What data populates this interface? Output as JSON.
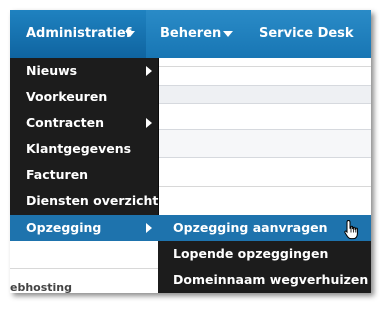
{
  "navbar": {
    "items": [
      {
        "label": "Administratief",
        "has_caret": true,
        "active": true
      },
      {
        "label": "Beheren",
        "has_caret": true,
        "active": false
      },
      {
        "label": "Service Desk",
        "has_caret": false,
        "active": false
      }
    ]
  },
  "dropdown": {
    "items": [
      {
        "label": "Nieuws",
        "has_submenu": true
      },
      {
        "label": "Voorkeuren",
        "has_submenu": false
      },
      {
        "label": "Contracten",
        "has_submenu": true
      },
      {
        "label": "Klantgegevens",
        "has_submenu": false
      },
      {
        "label": "Facturen",
        "has_submenu": false
      },
      {
        "label": "Diensten overzicht",
        "has_submenu": false
      },
      {
        "label": "Opzegging",
        "has_submenu": true,
        "active": true
      }
    ]
  },
  "submenu": {
    "items": [
      {
        "label": "Opzegging aanvragen",
        "active": true
      },
      {
        "label": "Lopende opzeggingen",
        "active": false
      },
      {
        "label": "Domeinnaam wegverhuizen",
        "active": false
      }
    ]
  },
  "background": {
    "partial_text": "ebhosting"
  },
  "colors": {
    "navbar": "#1876b4",
    "menu_bg": "#1c1c1c",
    "highlight": "#1e73ad",
    "text": "#ffffff"
  },
  "icons": {
    "submenu_indicator": "chevron-right-icon",
    "dropdown_caret": "caret-down-icon",
    "cursor": "hand-pointer-icon"
  }
}
